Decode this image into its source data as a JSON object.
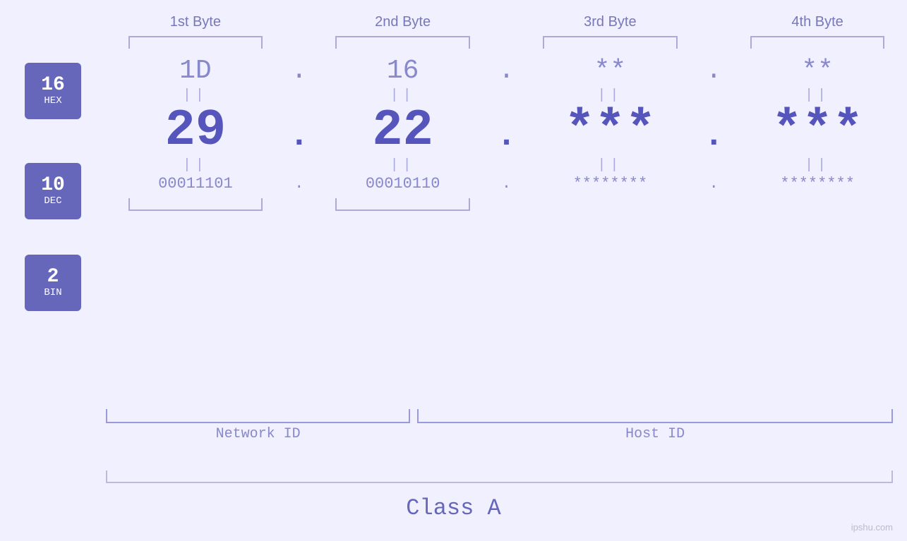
{
  "header": {
    "bytes": [
      "1st Byte",
      "2nd Byte",
      "3rd Byte",
      "4th Byte"
    ]
  },
  "badges": [
    {
      "number": "16",
      "label": "HEX"
    },
    {
      "number": "10",
      "label": "DEC"
    },
    {
      "number": "2",
      "label": "BIN"
    }
  ],
  "hex_values": [
    "1D",
    "16",
    "**",
    "**"
  ],
  "dec_values": [
    "29",
    "22",
    "***",
    "***"
  ],
  "bin_values": [
    "00011101",
    "00010110",
    "********",
    "********"
  ],
  "separators": [
    ".",
    ".",
    ".",
    "."
  ],
  "equals": "||",
  "labels": {
    "network_id": "Network ID",
    "host_id": "Host ID",
    "class": "Class A"
  },
  "watermark": "ipshu.com"
}
